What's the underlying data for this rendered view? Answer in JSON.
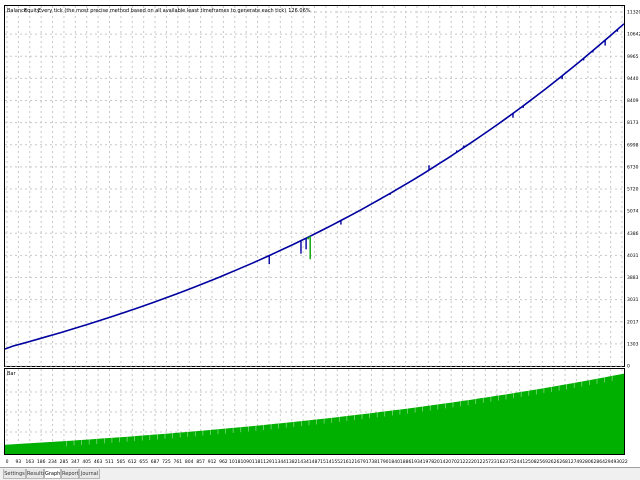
{
  "tabs": [
    {
      "label": "Settings",
      "active": false
    },
    {
      "label": "Results",
      "active": false
    },
    {
      "label": "Graph",
      "active": true
    },
    {
      "label": "Report",
      "active": false
    },
    {
      "label": "Journal",
      "active": false
    }
  ],
  "colors": {
    "balance": "#0000a0",
    "equity": "#00a000",
    "deposit_load": "#00b000",
    "grid": "#c8c8c8"
  },
  "chart_data": [
    {
      "type": "line",
      "panel": "balance-equity",
      "legend": [
        "Balance",
        "Equity"
      ],
      "title": "Every tick (the most precise method based on all available least timeframes to generate each tick)",
      "value_label": "126.06%",
      "y_ticks": [
        "11320",
        "10642",
        "9965",
        "9440",
        "8409",
        "8173",
        "6998",
        "6730",
        "5720",
        "5074",
        "4386",
        "4031",
        "3883",
        "3031",
        "2017",
        "1303",
        "0"
      ],
      "x_ticks": [
        "0",
        "93",
        "163",
        "186",
        "234",
        "285",
        "347",
        "405",
        "463",
        "511",
        "565",
        "612",
        "655",
        "687",
        "725",
        "761",
        "804",
        "857",
        "912",
        "962",
        "1018",
        "1090",
        "1181",
        "1291",
        "1344",
        "1382",
        "1434",
        "1487",
        "1514",
        "1552",
        "1612",
        "1679",
        "1738",
        "1790",
        "1840",
        "1886",
        "1934",
        "1978",
        "2014",
        "2070",
        "2122",
        "2201",
        "2257",
        "2316",
        "2375",
        "2441",
        "2508",
        "2569",
        "2626",
        "2681",
        "2749",
        "2806",
        "2864",
        "2949",
        "3022"
      ],
      "series": [
        {
          "name": "Balance",
          "x": [
            0,
            40,
            80,
            120,
            160,
            200,
            240,
            280,
            320,
            360,
            400,
            440,
            480,
            520,
            560,
            600,
            640,
            680,
            720,
            760,
            800,
            840,
            880,
            920,
            960,
            1000,
            1040,
            1080,
            1120,
            1160,
            1200,
            1240,
            1280,
            1320,
            1360,
            1400,
            1440,
            1480,
            1520,
            1560,
            1600,
            1640,
            1680,
            1720,
            1760,
            1800,
            1840,
            1880,
            1920,
            1960,
            2000,
            2040,
            2080,
            2120,
            2160,
            2200,
            2240,
            2280,
            2320,
            2360,
            2400,
            2440,
            2480,
            2520,
            2560,
            2600,
            2640,
            2680,
            2720,
            2760,
            2800,
            2840,
            2880,
            2920,
            2960,
            3000,
            3022
          ],
          "y": [
            1860,
            2010,
            2123,
            2239,
            2356,
            2474,
            2594,
            2716,
            2840,
            2966,
            3095,
            3225,
            3357,
            3491,
            3628,
            3767,
            3908,
            4052,
            4199,
            4348,
            4499,
            4654,
            4811,
            4971,
            5133,
            5298,
            5466,
            5637,
            5811,
            5988,
            6168,
            6351,
            6537,
            6726,
            6918,
            7114,
            7312,
            7514,
            7719,
            7928,
            8140,
            8356,
            8575,
            8798,
            9024,
            9254,
            9488,
            9726,
            9967,
            10212,
            10461,
            10714,
            10971,
            11232,
            11497,
            11767,
            12040,
            12318,
            12600,
            12886,
            13177,
            13472,
            13772,
            14076,
            14385,
            14699,
            15017,
            15340,
            15668,
            16001,
            16339,
            16682,
            17030,
            17383,
            17741,
            18105,
            18300
          ]
        }
      ],
      "equity_drawdowns": [
        {
          "x": 1290,
          "y": 6150
        },
        {
          "x": 1445,
          "y": 6680
        },
        {
          "x": 1470,
          "y": 6900
        },
        {
          "x": 1480,
          "y": 7400,
          "color": "equity"
        },
        {
          "x": 1490,
          "y": 6400,
          "color": "equity"
        },
        {
          "x": 1640,
          "y": 8150
        },
        {
          "x": 1880,
          "y": 9650
        },
        {
          "x": 2070,
          "y": 11150
        },
        {
          "x": 2205,
          "y": 11900
        },
        {
          "x": 2240,
          "y": 12150
        },
        {
          "x": 2480,
          "y": 13550
        },
        {
          "x": 2530,
          "y": 14050
        },
        {
          "x": 2720,
          "y": 15500
        },
        {
          "x": 2825,
          "y": 16450
        },
        {
          "x": 2870,
          "y": 16850
        },
        {
          "x": 2930,
          "y": 17200
        },
        {
          "x": 2990,
          "y": 17900
        }
      ]
    },
    {
      "type": "area",
      "panel": "deposit-load",
      "legend": [
        "Bar"
      ],
      "note": "deposit load histogram growing with the account"
    }
  ]
}
